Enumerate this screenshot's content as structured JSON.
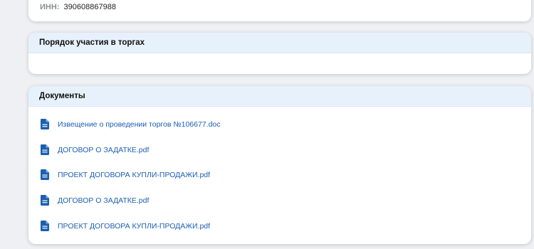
{
  "owner": {
    "inn_label": "ИНН:",
    "inn_value": "390608867988"
  },
  "procedure": {
    "title": "Порядок участия в торгах"
  },
  "documents": {
    "title": "Документы",
    "items": [
      {
        "name": "Извещение о проведении торгов №106677.doc",
        "icon": "document-icon"
      },
      {
        "name": "ДОГОВОР О ЗАДАТКЕ.pdf",
        "icon": "document-icon"
      },
      {
        "name": "ПРОЕКТ ДОГОВОРА КУПЛИ-ПРОДАЖИ.pdf",
        "icon": "document-icon"
      },
      {
        "name": "ДОГОВОР О ЗАДАТКЕ.pdf",
        "icon": "document-icon"
      },
      {
        "name": "ПРОЕКТ ДОГОВОРА КУПЛИ-ПРОДАЖИ.pdf",
        "icon": "document-icon"
      }
    ]
  },
  "colors": {
    "link": "#1c5fb0",
    "header_bg": "#e7f1fb",
    "page_bg": "#eef0f3"
  }
}
